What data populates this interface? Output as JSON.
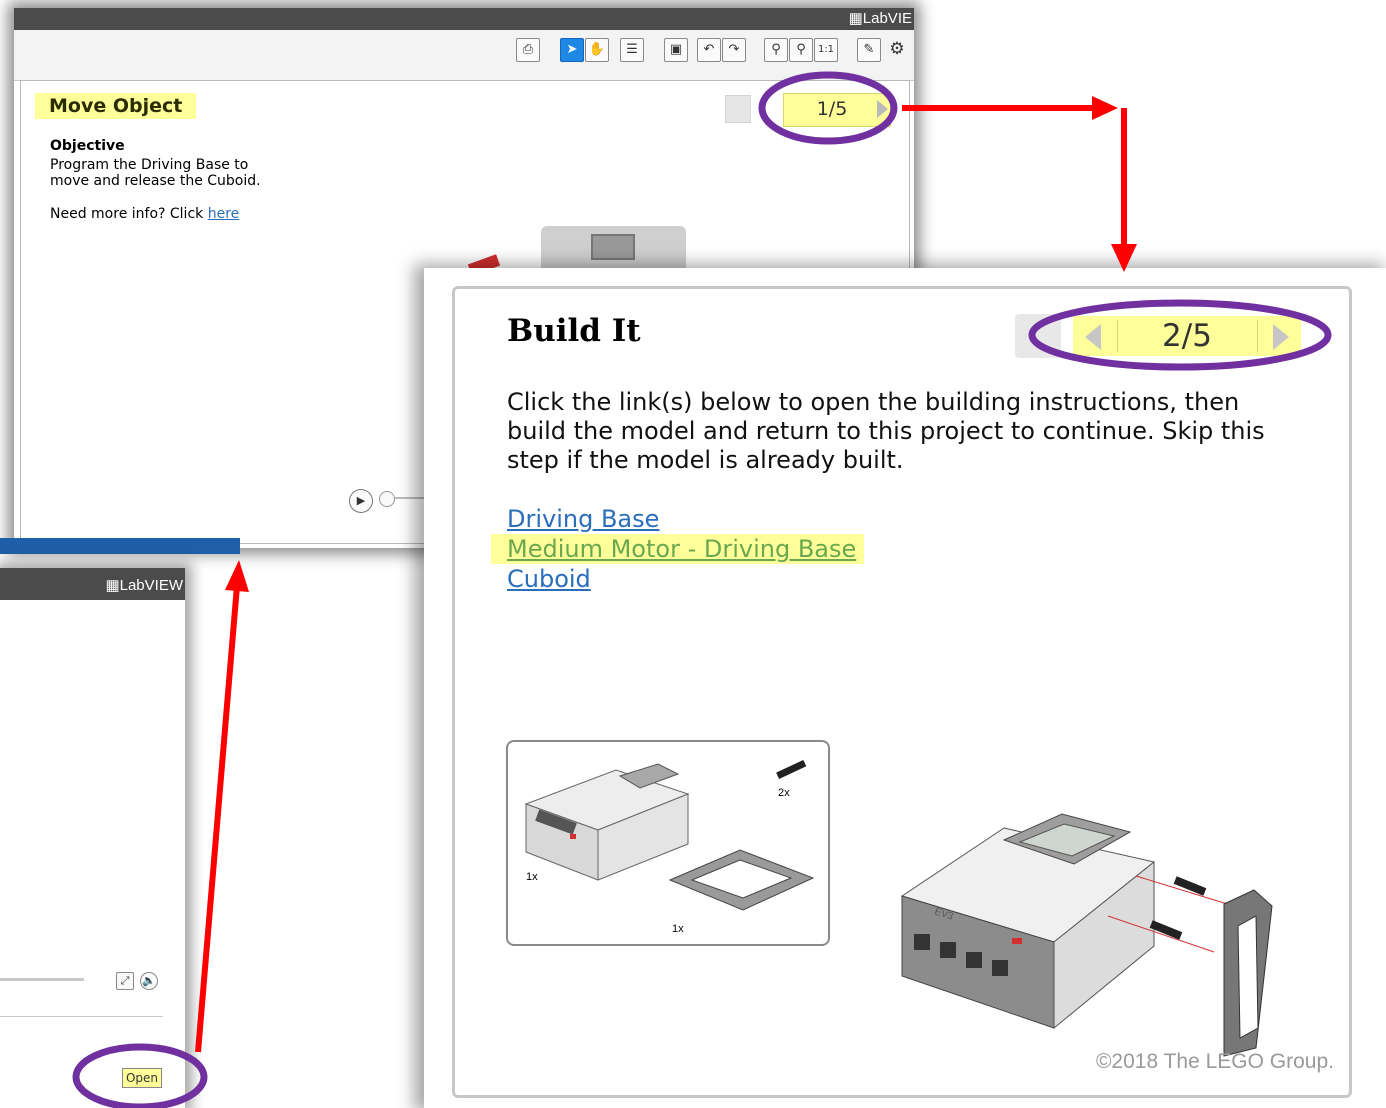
{
  "back_window_top": {
    "app_logo": "LabVIE",
    "toolbar_zoom_label": "1:1",
    "title": "Move Object",
    "objective_heading": "Objective",
    "objective_text": "Program the Driving Base to move and release the Cuboid.",
    "more_info_prefix": "Need more info? Click ",
    "more_info_link": "here",
    "page_indicator": "1/5"
  },
  "back_window_bottom": {
    "app_logo": "LabVIEW",
    "open_button": "Open"
  },
  "build_panel": {
    "title": "Build It",
    "page_indicator": "2/5",
    "instructions": "Click the link(s) below to open the building instructions, then build the model and return to this project to continue. Skip this step if the model is already built.",
    "links": [
      "Driving Base",
      "Medium Motor - Driving Base",
      "Cuboid"
    ],
    "parts_qty": [
      "2x",
      "1x",
      "1x"
    ],
    "brick_label": "EV3",
    "copyright": "©2018 The LEGO Group."
  },
  "colors": {
    "highlight": "#ffff99",
    "annotation_ellipse": "#7030a0",
    "annotation_arrow": "#ff0000",
    "link": "#2a6ebb",
    "link_highlighted": "#6aa84f"
  },
  "icons": [
    "document-icon",
    "pointer-icon",
    "hand-icon",
    "comment-icon",
    "save-icon",
    "undo-icon",
    "redo-icon",
    "zoom-out-icon",
    "zoom-in-icon",
    "actual-size-icon",
    "pen-icon",
    "settings-icon",
    "play-icon",
    "fullscreen-icon",
    "speaker-icon"
  ]
}
